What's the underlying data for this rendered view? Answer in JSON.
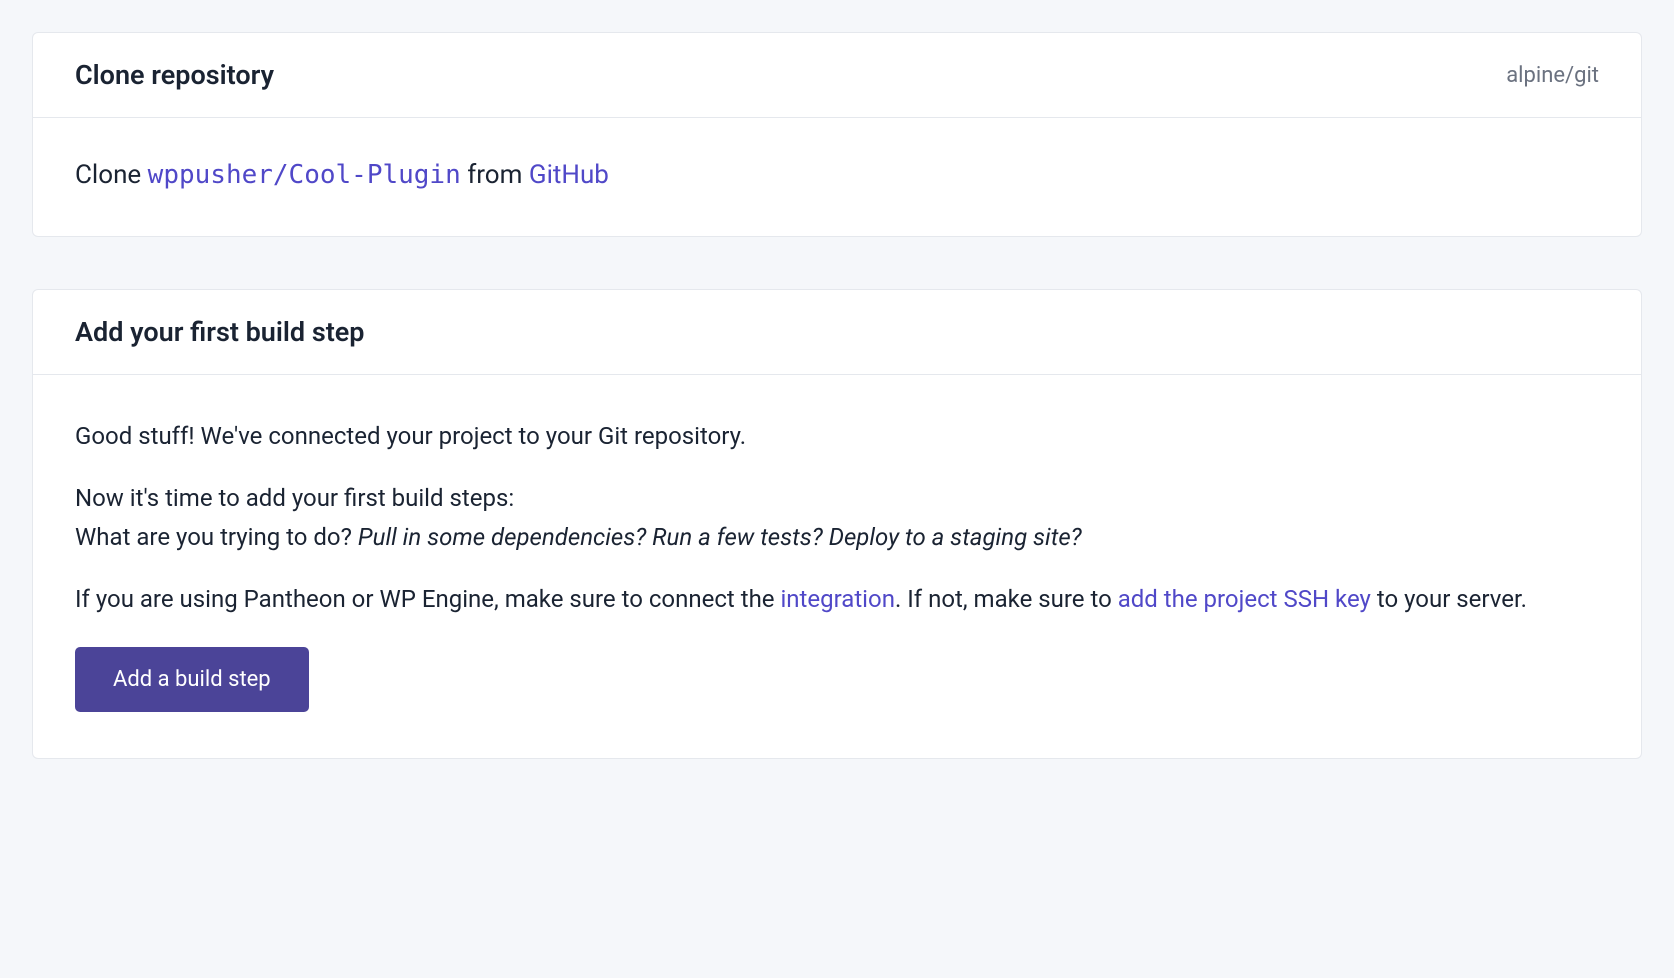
{
  "card1": {
    "title": "Clone repository",
    "meta": "alpine/git",
    "clone_prefix": "Clone ",
    "repo": "wppusher/Cool-Plugin",
    "from_text": " from ",
    "provider": "GitHub"
  },
  "card2": {
    "title": "Add your first build step",
    "p1": "Good stuff! We've connected your project to your Git repository.",
    "p2_line1": "Now it's time to add your first build steps:",
    "p2_question": "What are you trying to do? ",
    "p2_em": "Pull in some dependencies? Run a few tests? Deploy to a staging site?",
    "p3_a": "If you are using Pantheon or WP Engine, make sure to connect the ",
    "p3_link1": "integration",
    "p3_b": ". If not, make sure to ",
    "p3_link2": "add the project SSH key",
    "p3_c": " to your server.",
    "button_label": "Add a build step"
  }
}
